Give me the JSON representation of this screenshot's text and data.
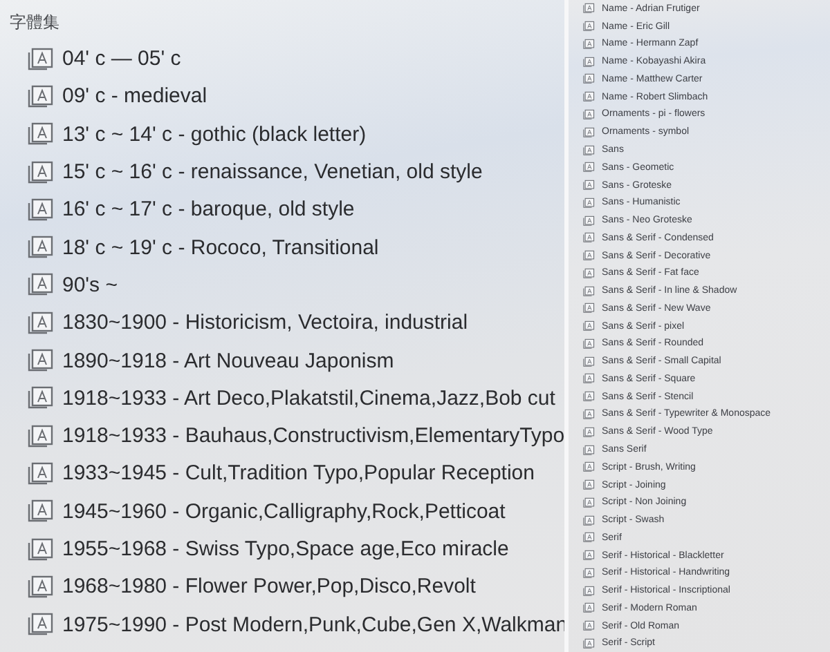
{
  "collection": {
    "title": "字體集",
    "items": [
      "04' c — 05' c",
      "09' c - medieval",
      "13' c ~ 14' c - gothic (black letter)",
      "15' c ~ 16' c - renaissance, Venetian, old style",
      "16' c ~ 17' c - baroque, old style",
      "18' c ~ 19' c - Rococo, Transitional",
      "90's ~",
      "1830~1900 - Historicism, Vectoira, industrial",
      "1890~1918 - Art Nouveau Japonism",
      "1918~1933 - Art Deco,Plakatstil,Cinema,Jazz,Bob cut",
      "1918~1933 - Bauhaus,Constructivism,ElementaryTypo",
      "1933~1945 - Cult,Tradition Typo,Popular Reception",
      "1945~1960 - Organic,Calligraphy,Rock,Petticoat",
      "1955~1968 - Swiss Typo,Space age,Eco miracle",
      "1968~1980 - Flower Power,Pop,Disco,Revolt",
      "1975~1990 - Post Modern,Punk,Cube,Gen X,Walkman"
    ]
  },
  "sidebar": {
    "items": [
      "Name - Adrian Frutiger",
      "Name - Eric Gill",
      "Name - Hermann Zapf",
      "Name - Kobayashi Akira",
      "Name - Matthew Carter",
      "Name - Robert Slimbach",
      "Ornaments - pi - flowers",
      "Ornaments - symbol",
      "Sans",
      "Sans - Geometic",
      "Sans - Groteske",
      "Sans - Humanistic",
      "Sans - Neo Groteske",
      "Sans & Serif - Condensed",
      "Sans & Serif - Decorative",
      "Sans & Serif - Fat face",
      "Sans & Serif - In line & Shadow",
      "Sans & Serif - New Wave",
      "Sans & Serif - pixel",
      "Sans & Serif - Rounded",
      "Sans & Serif - Small Capital",
      "Sans & Serif - Square",
      "Sans & Serif - Stencil",
      "Sans & Serif - Typewriter & Monospace",
      "Sans & Serif - Wood Type",
      "Sans Serif",
      "Script - Brush, Writing",
      "Script - Joining",
      "Script - Non Joining",
      "Script - Swash",
      "Serif",
      "Serif - Historical - Blackletter",
      "Serif - Historical - Handwriting",
      "Serif - Historical - Inscriptional",
      "Serif - Modern Roman",
      "Serif - Old Roman",
      "Serif - Script"
    ]
  }
}
